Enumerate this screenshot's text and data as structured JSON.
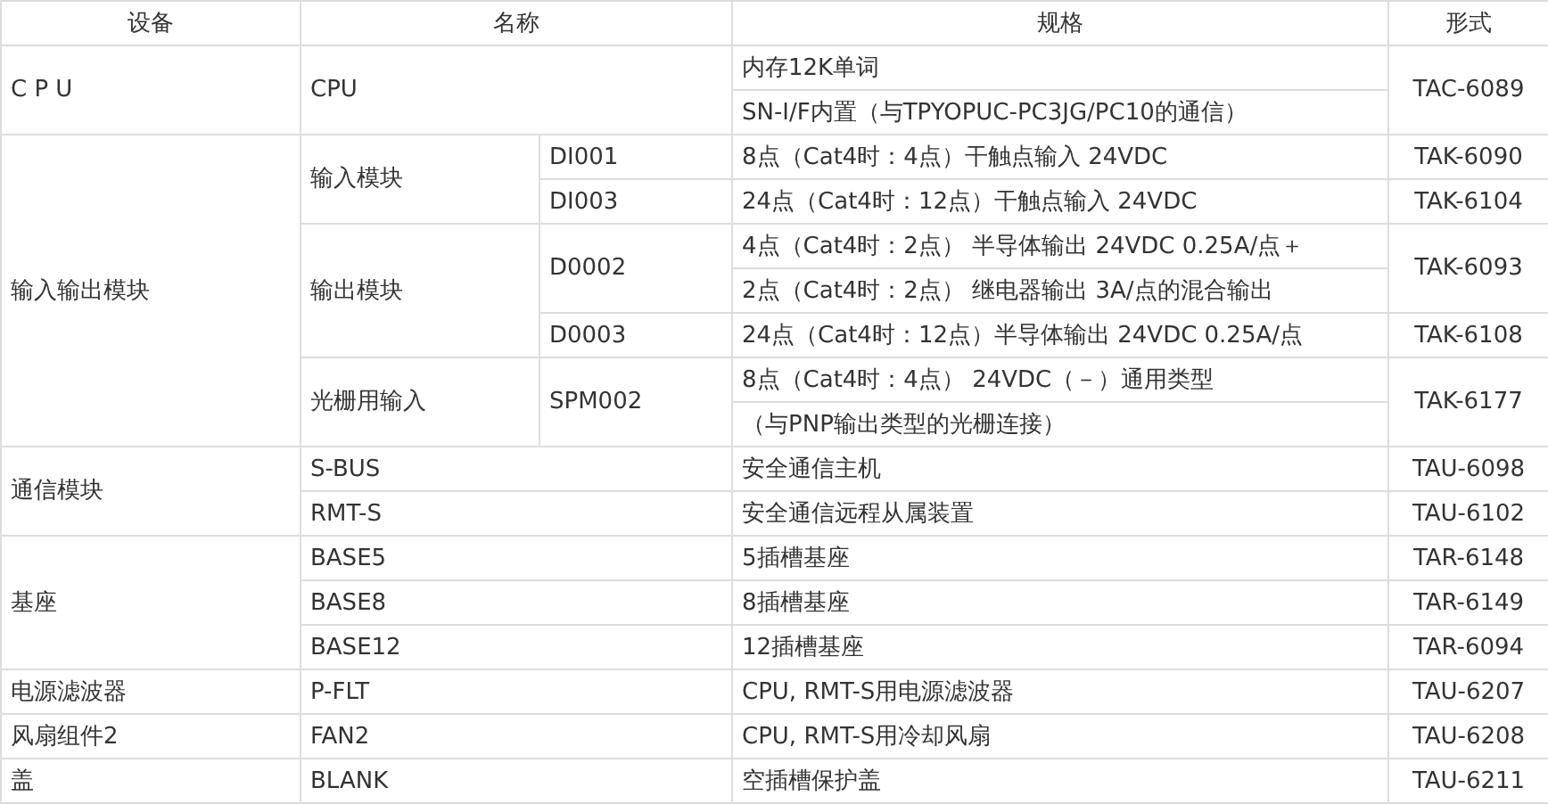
{
  "table": {
    "columns": [
      "设备",
      "名称",
      "规格",
      "形式"
    ],
    "groups": [
      {
        "device": "C P U",
        "entries": [
          {
            "name": "CPU",
            "variants": [
              {
                "specs": [
                  "内存12K单词",
                  "SN-I/F内置（与TPYOPUC-PC3JG/PC10的通信）"
                ],
                "form": "TAC-6089"
              }
            ]
          }
        ]
      },
      {
        "device": "输入输出模块",
        "entries": [
          {
            "name": "输入模块",
            "variants": [
              {
                "model": "DI001",
                "specs": [
                  "8点（Cat4时：4点）干触点输入 24VDC"
                ],
                "form": "TAK-6090"
              },
              {
                "model": "DI003",
                "specs": [
                  "24点（Cat4时：12点）干触点输入 24VDC"
                ],
                "form": "TAK-6104"
              }
            ]
          },
          {
            "name": "输出模块",
            "variants": [
              {
                "model": "D0002",
                "specs": [
                  "4点（Cat4时：2点） 半导体输出 24VDC 0.25A/点＋",
                  "2点（Cat4时：2点） 继电器输出 3A/点的混合输出"
                ],
                "form": "TAK-6093"
              },
              {
                "model": "D0003",
                "specs": [
                  "24点（Cat4时：12点）半导体输出 24VDC 0.25A/点"
                ],
                "form": "TAK-6108"
              }
            ]
          },
          {
            "name": "光栅用输入",
            "variants": [
              {
                "model": "SPM002",
                "specs": [
                  "8点（Cat4时：4点） 24VDC（－）通用类型",
                  "（与PNP输出类型的光栅连接）"
                ],
                "form": "TAK-6177"
              }
            ]
          }
        ]
      },
      {
        "device": "通信模块",
        "entries": [
          {
            "name": "S-BUS",
            "variants": [
              {
                "specs": [
                  "安全通信主机"
                ],
                "form": "TAU-6098"
              }
            ]
          },
          {
            "name": "RMT-S",
            "variants": [
              {
                "specs": [
                  "安全通信远程从属装置"
                ],
                "form": "TAU-6102"
              }
            ]
          }
        ]
      },
      {
        "device": "基座",
        "entries": [
          {
            "name": "BASE5",
            "variants": [
              {
                "specs": [
                  "5插槽基座"
                ],
                "form": "TAR-6148"
              }
            ]
          },
          {
            "name": "BASE8",
            "variants": [
              {
                "specs": [
                  "8插槽基座"
                ],
                "form": "TAR-6149"
              }
            ]
          },
          {
            "name": "BASE12",
            "variants": [
              {
                "specs": [
                  "12插槽基座"
                ],
                "form": "TAR-6094"
              }
            ]
          }
        ]
      },
      {
        "device": "电源滤波器",
        "entries": [
          {
            "name": "P-FLT",
            "variants": [
              {
                "specs": [
                  "CPU, RMT-S用电源滤波器"
                ],
                "form": "TAU-6207"
              }
            ]
          }
        ]
      },
      {
        "device": "风扇组件2",
        "entries": [
          {
            "name": "FAN2",
            "variants": [
              {
                "specs": [
                  "CPU, RMT-S用冷却风扇"
                ],
                "form": "TAU-6208"
              }
            ]
          }
        ]
      },
      {
        "device": "盖",
        "entries": [
          {
            "name": "BLANK",
            "variants": [
              {
                "specs": [
                  "空插槽保护盖"
                ],
                "form": "TAU-6211"
              }
            ]
          }
        ]
      }
    ]
  }
}
